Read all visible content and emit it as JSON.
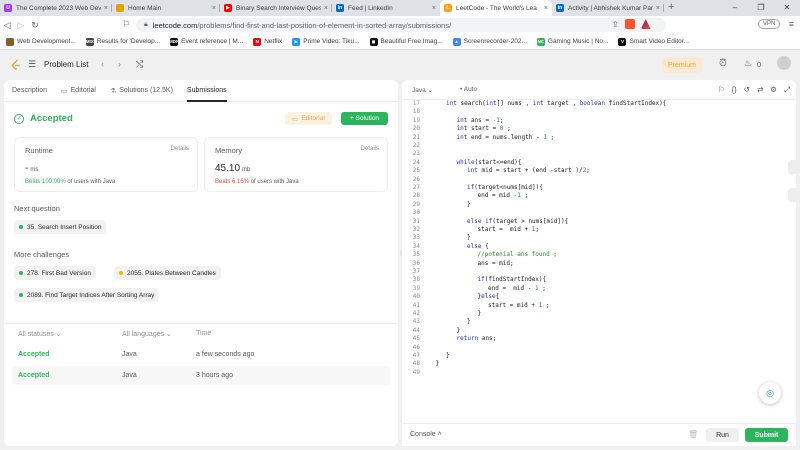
{
  "browser": {
    "tabs": [
      {
        "title": "The Complete 2023 Web Develo",
        "favicon_color": "#a435f0",
        "favicon_glyph": "U"
      },
      {
        "title": "Home Main",
        "favicon_color": "#e8a200",
        "favicon_glyph": ""
      },
      {
        "title": "Binary Search Interview Questio",
        "favicon_color": "#ff0000",
        "favicon_glyph": "▶"
      },
      {
        "title": "Feed | LinkedIn",
        "favicon_color": "#0a66c2",
        "favicon_glyph": "in"
      },
      {
        "title": "LeetCode - The World's Lea",
        "favicon_color": "#ffa116",
        "favicon_glyph": "L"
      },
      {
        "title": "Activity | Abhishek Kumar Pand",
        "favicon_color": "#0a66c2",
        "favicon_glyph": "in"
      }
    ],
    "active_tab_index": 4,
    "new_tab_label": "+",
    "url_host": "leetcode.com",
    "url_path": "/problems/find-first-and-last-position-of-element-in-sorted-array/submissions/",
    "vpn_label": "VPN",
    "bookmarks": [
      {
        "label": "Web Development...",
        "color": "#8b5a2b",
        "glyph": ""
      },
      {
        "label": "Results for 'Develop...",
        "color": "#444",
        "glyph": "MIX"
      },
      {
        "label": "Event reference | M...",
        "color": "#111",
        "glyph": "MDN"
      },
      {
        "label": "Netflix",
        "color": "#e50914",
        "glyph": "N"
      },
      {
        "label": "Prime Video: Tiku...",
        "color": "#1a98ff",
        "glyph": "▶"
      },
      {
        "label": "Beautiful Free Imag...",
        "color": "#111",
        "glyph": "◼"
      },
      {
        "label": "Screenrecorder-202...",
        "color": "#4285f4",
        "glyph": "▲"
      },
      {
        "label": "Gaming Music | No...",
        "color": "#2db55d",
        "glyph": "NC"
      },
      {
        "label": "Smart Video Editor...",
        "color": "#111",
        "glyph": "V"
      },
      {
        "label": "Smart Video Editor...",
        "color": "#223",
        "glyph": "◼"
      }
    ]
  },
  "lc_nav": {
    "problem_list_label": "Problem List",
    "premium_label": "Premium",
    "streak_count": "0"
  },
  "left": {
    "tabs": [
      {
        "label": "Description",
        "icon": "description-icon"
      },
      {
        "label": "Editorial",
        "icon": "editorial-icon"
      },
      {
        "label": "Solutions (12.5K)",
        "icon": "solutions-icon"
      },
      {
        "label": "Submissions",
        "icon": "submissions-icon",
        "active": true
      }
    ],
    "accepted_title": "Accepted",
    "editorial_btn": "Editorial",
    "solution_btn": "+ Solution",
    "runtime": {
      "label": "Runtime",
      "details": "Details",
      "value": "-",
      "unit": "ms",
      "beats_pct": "Beats 100.00%",
      "beats_suffix": "of users with Java"
    },
    "memory": {
      "label": "Memory",
      "details": "Details",
      "value": "45.10",
      "unit": "mb",
      "beats_pct": "Beats 6.16%",
      "beats_suffix": "of users with Java"
    },
    "next_question_title": "Next question",
    "next_question": {
      "label": "35. Search Insert Position",
      "dot_color": "#2db55d"
    },
    "more_challenges_title": "More challenges",
    "challenges": [
      {
        "label": "278. First Bad Version",
        "dot_color": "#2db55d"
      },
      {
        "label": "2055. Plates Between Candles",
        "dot_color": "#ffb800"
      },
      {
        "label": "2089. Find Target Indices After Sorting Array",
        "dot_color": "#2db55d"
      }
    ],
    "submissions_header": {
      "status": "All statuses",
      "lang": "All languages",
      "time": "Time"
    },
    "submissions": [
      {
        "status": "Accepted",
        "lang": "Java",
        "time": "a few seconds ago"
      },
      {
        "status": "Accepted",
        "lang": "Java",
        "time": "3 hours ago"
      }
    ]
  },
  "editor": {
    "language": "Java",
    "auto_label": "Auto",
    "lines": [
      {
        "n": "17",
        "i": 1,
        "t": "int search(int[] nums , int target , boolean findStartIndex){"
      },
      {
        "n": "18",
        "i": 1,
        "t": ""
      },
      {
        "n": "19",
        "i": 2,
        "t": "int ans = -1;"
      },
      {
        "n": "20",
        "i": 2,
        "t": "int start = 0 ;"
      },
      {
        "n": "21",
        "i": 2,
        "t": "int end = nums.length - 1 ;"
      },
      {
        "n": "22",
        "i": 2,
        "t": ""
      },
      {
        "n": "23",
        "i": 2,
        "t": ""
      },
      {
        "n": "24",
        "i": 2,
        "t": "while(start<=end){"
      },
      {
        "n": "25",
        "i": 3,
        "t": "int mid = start + (end -start )/2;"
      },
      {
        "n": "26",
        "i": 3,
        "t": ""
      },
      {
        "n": "27",
        "i": 3,
        "t": "if(target<nums[mid]){"
      },
      {
        "n": "28",
        "i": 4,
        "t": "end = mid -1 ;"
      },
      {
        "n": "29",
        "i": 3,
        "t": "}"
      },
      {
        "n": "30",
        "i": 3,
        "t": ""
      },
      {
        "n": "31",
        "i": 3,
        "t": "else if(target > nums[mid]){"
      },
      {
        "n": "32",
        "i": 4,
        "t": "start =  mid + 1;"
      },
      {
        "n": "33",
        "i": 3,
        "t": "}"
      },
      {
        "n": "34",
        "i": 3,
        "t": "else {"
      },
      {
        "n": "35",
        "i": 4,
        "t": "//potenial ans found ;"
      },
      {
        "n": "36",
        "i": 4,
        "t": "ans = mid;"
      },
      {
        "n": "37",
        "i": 4,
        "t": ""
      },
      {
        "n": "38",
        "i": 4,
        "t": "if(findStartIndex){"
      },
      {
        "n": "39",
        "i": 5,
        "t": "end =  mid - 1 ;"
      },
      {
        "n": "40",
        "i": 4,
        "t": "}else{"
      },
      {
        "n": "41",
        "i": 5,
        "t": "start = mid + 1 ;"
      },
      {
        "n": "42",
        "i": 4,
        "t": "}"
      },
      {
        "n": "43",
        "i": 3,
        "t": "}"
      },
      {
        "n": "44",
        "i": 2,
        "t": "}"
      },
      {
        "n": "45",
        "i": 2,
        "t": "return ans;"
      },
      {
        "n": "46",
        "i": 2,
        "t": ""
      },
      {
        "n": "47",
        "i": 1,
        "t": "}"
      },
      {
        "n": "48",
        "i": 0,
        "t": "}"
      },
      {
        "n": "49",
        "i": 0,
        "t": ""
      }
    ],
    "console_label": "Console",
    "run_label": "Run",
    "submit_label": "Submit"
  },
  "colors": {
    "accent_green": "#2db55d",
    "premium_orange": "#ffa116",
    "beats_red": "#ef4743"
  }
}
